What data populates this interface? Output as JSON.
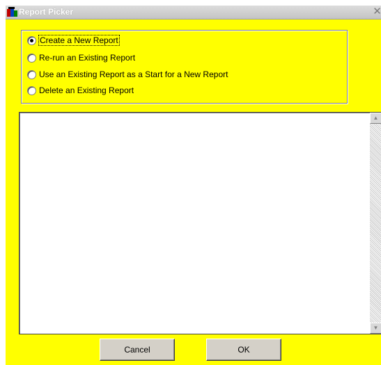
{
  "window": {
    "title": "Report Picker",
    "close_glyph": "✕"
  },
  "options": [
    {
      "label": "Create a New Report",
      "selected": true
    },
    {
      "label": "Re-run an Existing Report",
      "selected": false
    },
    {
      "label": "Use an Existing Report as a Start for a New Report",
      "selected": false
    },
    {
      "label": "Delete an Existing Report",
      "selected": false
    }
  ],
  "listbox": {
    "items": [],
    "scroll_up_glyph": "▲",
    "scroll_down_glyph": "▼"
  },
  "buttons": {
    "cancel_label": "Cancel",
    "ok_label": "OK"
  },
  "colors": {
    "dialog_background": "#ffff00",
    "list_background": "#ffffff"
  },
  "icons": {
    "app": "report-app-icon",
    "close": "close-icon"
  }
}
